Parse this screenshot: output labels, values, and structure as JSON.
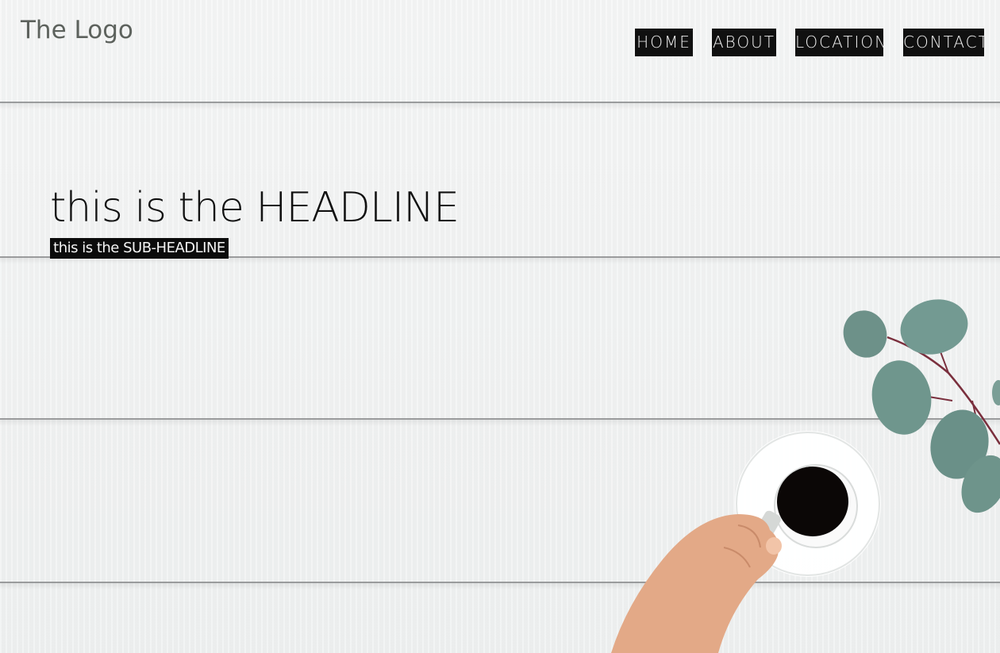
{
  "header": {
    "logo_text": "The Logo"
  },
  "nav": {
    "items": [
      {
        "label": "HOME"
      },
      {
        "label": "ABOUT"
      },
      {
        "label": "LOCATION"
      },
      {
        "label": "CONTACT"
      }
    ]
  },
  "hero": {
    "headline": "this is the HEADLINE",
    "subheadline": "this is the SUB-HEADLINE",
    "background_image": "white-wood-planks-with-coffee-cup-hand-and-eucalyptus-branch"
  },
  "colors": {
    "logo": "#5d625d",
    "nav_bg": "#101010",
    "nav_text": "#f0f0f0",
    "headline": "#111111",
    "sub_bg": "#0b0b0b"
  }
}
